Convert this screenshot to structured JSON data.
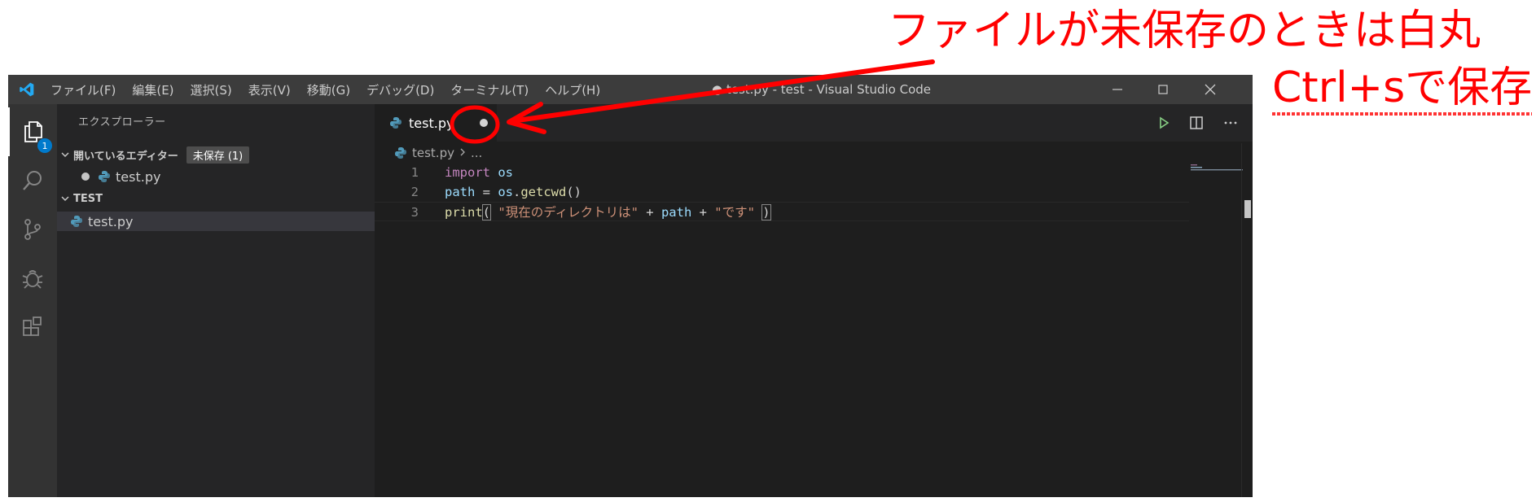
{
  "annotation": {
    "line1": "ファイルが未保存のときは白丸",
    "line2": "Ctrl+sで保存",
    "color": "#ff0000"
  },
  "window": {
    "title": "● test.py - test - Visual Studio Code",
    "menu": [
      "ファイル(F)",
      "編集(E)",
      "選択(S)",
      "表示(V)",
      "移動(G)",
      "デバッグ(D)",
      "ターミナル(T)",
      "ヘルプ(H)"
    ]
  },
  "activity": {
    "items": [
      "files-icon",
      "search-icon",
      "source-control-icon",
      "debug-icon",
      "extensions-icon"
    ],
    "badge": "1"
  },
  "sidebar": {
    "title": "エクスプローラー",
    "open_editors_label": "開いているエディター",
    "unsaved_badge": "未保存 (1)",
    "open_file": "test.py",
    "folder_label": "TEST",
    "folder_file": "test.py"
  },
  "editor": {
    "tab_label": "test.py",
    "breadcrumb_file": "test.py",
    "breadcrumb_more": "...",
    "lines": [
      {
        "no": "1",
        "tokens": [
          [
            "kw",
            "import"
          ],
          [
            "txt",
            " "
          ],
          [
            "var",
            "os"
          ]
        ]
      },
      {
        "no": "2",
        "tokens": [
          [
            "var",
            "path"
          ],
          [
            "txt",
            " = "
          ],
          [
            "var",
            "os"
          ],
          [
            "txt",
            "."
          ],
          [
            "fn",
            "getcwd"
          ],
          [
            "txt",
            "()"
          ]
        ]
      },
      {
        "no": "3",
        "tokens": [
          [
            "fn",
            "print"
          ],
          [
            "br",
            "("
          ],
          [
            "txt",
            " "
          ],
          [
            "str",
            "\"現在のディレクトリは\""
          ],
          [
            "txt",
            " + "
          ],
          [
            "var",
            "path"
          ],
          [
            "txt",
            " + "
          ],
          [
            "str",
            "\"です\""
          ],
          [
            "txt",
            " "
          ],
          [
            "br",
            ")"
          ]
        ]
      }
    ]
  },
  "colors": {
    "activity_bar": "#333333",
    "sidebar": "#252526",
    "editor": "#1e1e1e",
    "title_bar": "#3c3c3c",
    "accent_badge": "#007acc"
  }
}
